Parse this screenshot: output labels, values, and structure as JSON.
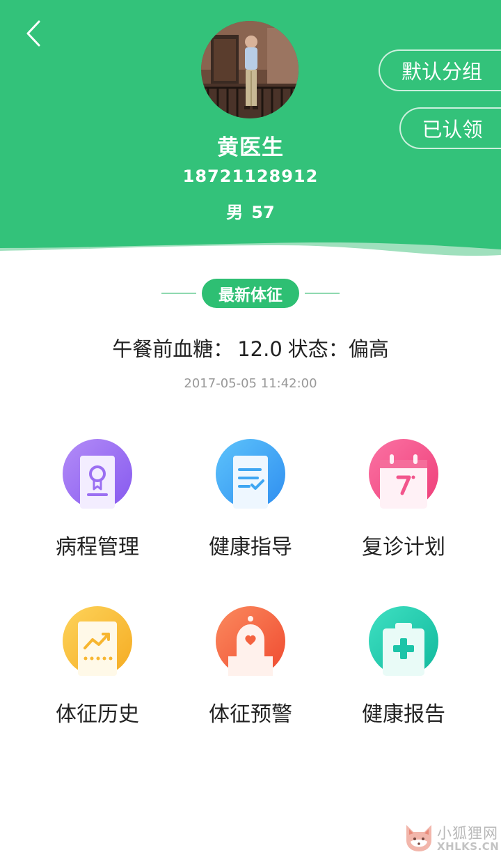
{
  "header": {
    "background_color": "#33c27a",
    "back_icon": "chevron-left-icon",
    "doctor": {
      "name": "黄医生",
      "phone": "18721128912",
      "gender": "男",
      "age": "57"
    },
    "buttons": {
      "default_group": "默认分组",
      "claimed": "已认领"
    }
  },
  "vitals": {
    "section_title": "最新体征",
    "label": "午餐前血糖：",
    "value": "12.0",
    "status_label": "状态：",
    "status_value": "偏高",
    "timestamp": "2017-05-05 11:42:00"
  },
  "menu": [
    {
      "label": "病程管理",
      "icon": "certificate-icon",
      "color": "#9b6ff2"
    },
    {
      "label": "健康指导",
      "icon": "checklist-icon",
      "color": "#3fa6f2"
    },
    {
      "label": "复诊计划",
      "icon": "calendar-icon",
      "color": "#f2558c"
    },
    {
      "label": "体征历史",
      "icon": "trend-chart-icon",
      "color": "#f7be36"
    },
    {
      "label": "体征预警",
      "icon": "alarm-bell-icon",
      "color": "#f4623f"
    },
    {
      "label": "健康报告",
      "icon": "medical-cross-icon",
      "color": "#21c9ae"
    }
  ],
  "watermark": {
    "cn": "小狐狸网",
    "en": "XHLKS.CN"
  }
}
